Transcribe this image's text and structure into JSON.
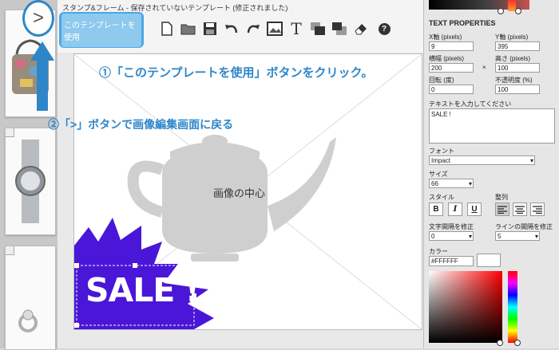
{
  "header": {
    "title": "スタンプ&フレーム  -  保存されていないテンプレート (修正されました)",
    "use_template_button": "このテンプレートを使用",
    "expand_button": ">"
  },
  "toolbar": {
    "tools": [
      "new-page-icon",
      "open-folder-icon",
      "save-icon",
      "undo-icon",
      "redo-icon",
      "image-icon",
      "text-icon",
      "bring-forward-icon",
      "send-backward-icon",
      "eraser-icon",
      "help-icon"
    ],
    "text_glyph": "T",
    "help_glyph": "?"
  },
  "annotations": {
    "step1": "①「このテンプレートを使用」ボタンをクリック。",
    "step2": "②「>」ボタンで画像編集画面に戻る"
  },
  "canvas": {
    "center_label": "画像の中心",
    "stamp_text": "SALE !"
  },
  "panel": {
    "title": "TEXT PROPERTIES",
    "x_label": "X軸 (pixels)",
    "x_value": "9",
    "y_label": "Y軸 (pixels)",
    "y_value": "395",
    "width_label": "横幅 (pixels)",
    "width_value": "200",
    "times": "×",
    "height_label": "高さ (pixels)",
    "height_value": "100",
    "rotation_label": "回転 (度)",
    "rotation_value": "0",
    "opacity_label": "不透明度 (%)",
    "opacity_value": "100",
    "text_prompt": "テキストを入力してください",
    "text_value": "SALE !",
    "font_label": "フォント",
    "font_value": "Impact",
    "size_label": "サイズ",
    "size_value": "66",
    "style_label": "スタイル",
    "align_label": "整列",
    "bold": "B",
    "italic": "I",
    "underline": "U",
    "letter_spacing_label": "文字間隔を修正",
    "letter_spacing_value": "0",
    "line_spacing_label": "ラインの間隔を修正",
    "line_spacing_value": "5",
    "color_label": "カラー",
    "color_value": "#FFFFFF"
  },
  "colors": {
    "accent": "#2e86c9",
    "stamp_purple": "#4a16d8",
    "teapot_gray": "#cfcfcf"
  }
}
